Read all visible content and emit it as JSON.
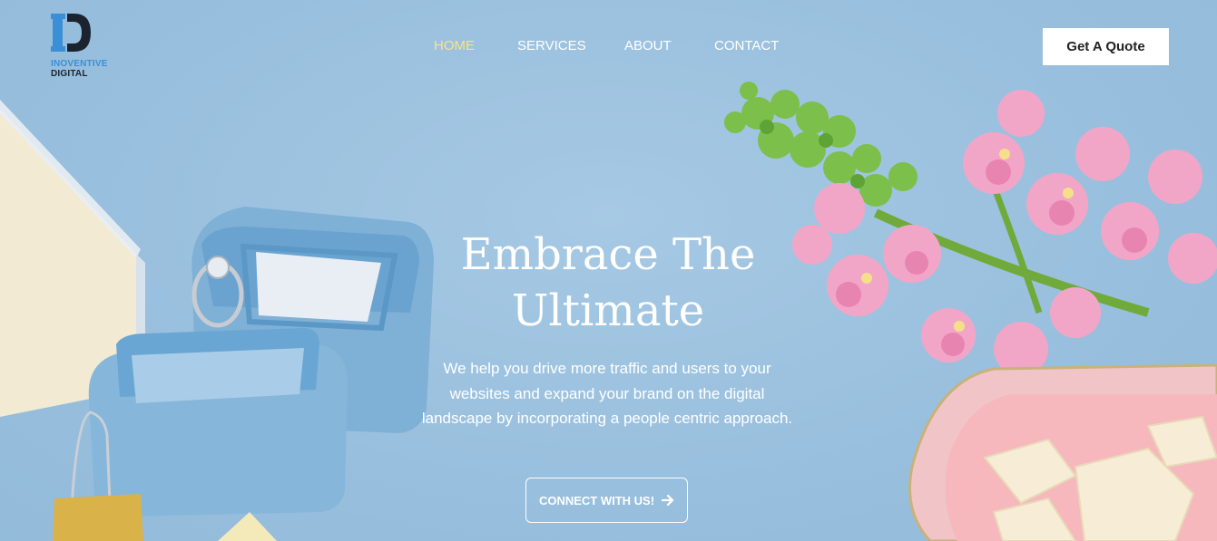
{
  "brand": {
    "line1": "INOVENTIVE",
    "line2": "DIGITAL"
  },
  "nav": {
    "items": [
      {
        "label": "HOME",
        "active": true
      },
      {
        "label": "SERVICES",
        "active": false
      },
      {
        "label": "ABOUT",
        "active": false
      },
      {
        "label": "CONTACT",
        "active": false
      }
    ],
    "quote_label": "Get A Quote"
  },
  "hero": {
    "headline_line1": "Embrace The",
    "headline_line2": "Ultimate",
    "description": "We help you drive more traffic and users to your websites and expand your brand on the digital landscape by incorporating a people centric approach.",
    "cta_label": "CONNECT WITH US!",
    "cta_icon": "arrow-right-icon"
  },
  "colors": {
    "background": "#9cc2e0",
    "nav_active": "#f7e38a",
    "logo_blue": "#3a8fd6",
    "logo_dark": "#1c2330"
  }
}
